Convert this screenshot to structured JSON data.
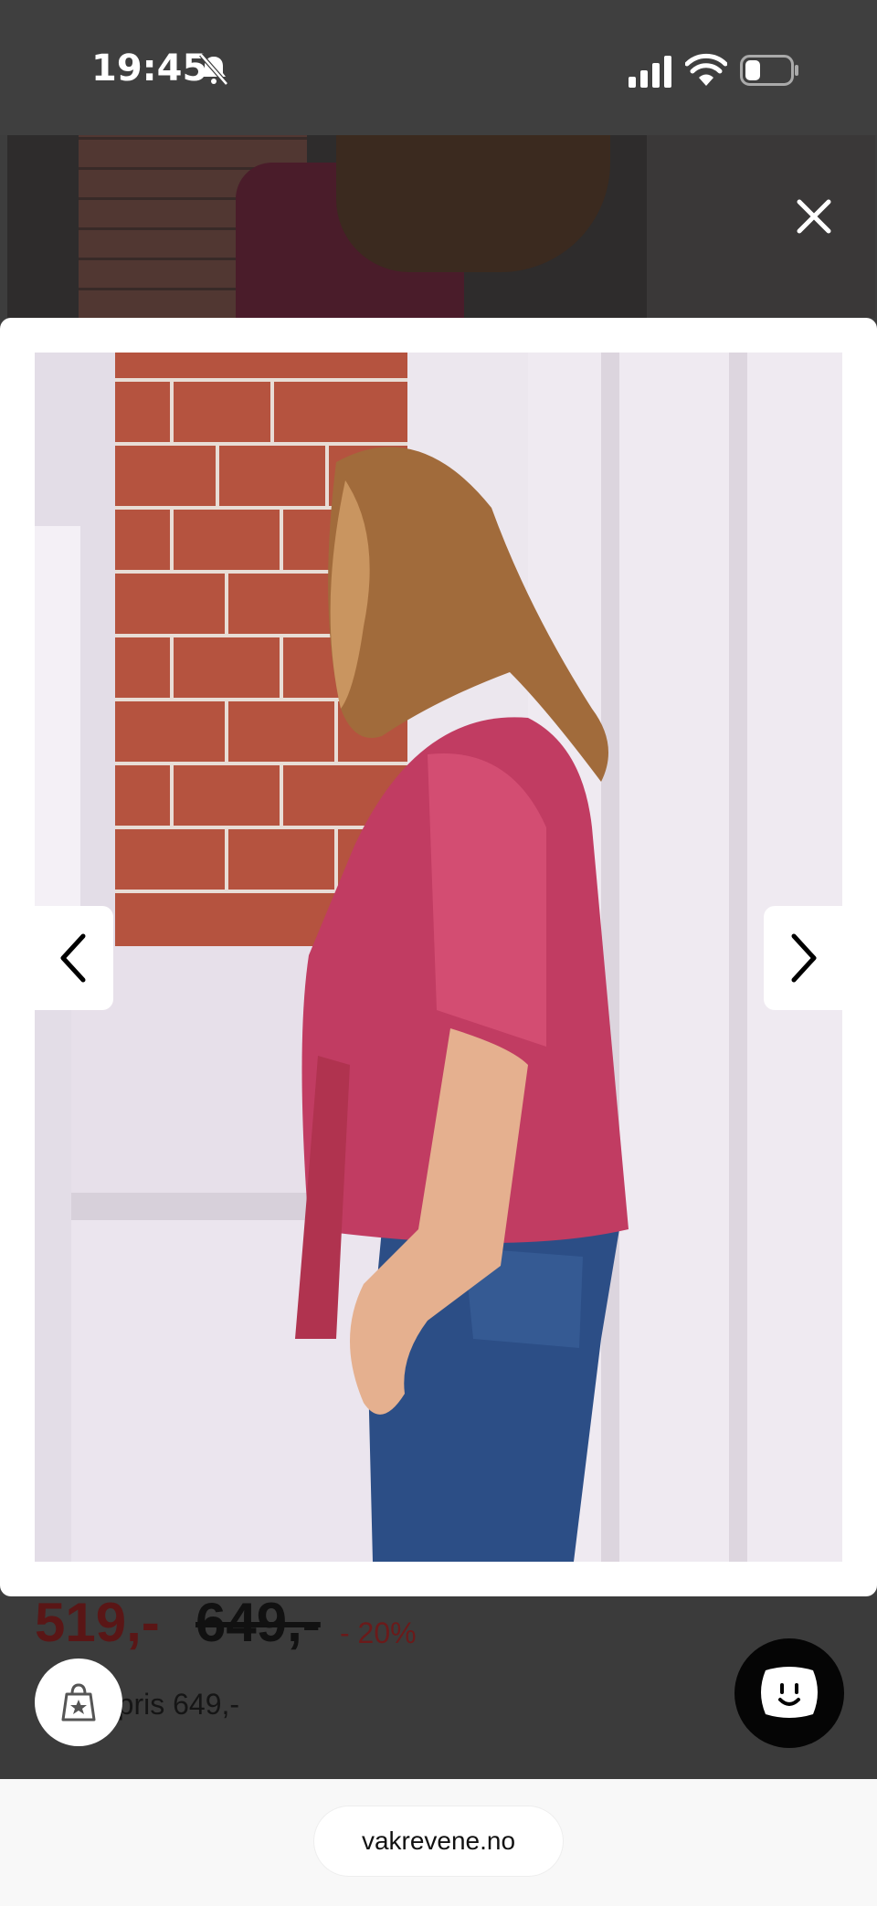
{
  "status_bar": {
    "time": "19:45"
  },
  "gallery": {
    "close_label": "close",
    "prev_label": "previous image",
    "next_label": "next image"
  },
  "product": {
    "price": "519,-",
    "old_price": "649,-",
    "discount": "- 20%",
    "regular_price_partial": "rpris 649,-"
  },
  "browser": {
    "url": "vakrevene.no"
  },
  "colors": {
    "accent_price": "#5a1616",
    "modal_bg": "#ffffff",
    "overlay": "#3d3d3d"
  }
}
